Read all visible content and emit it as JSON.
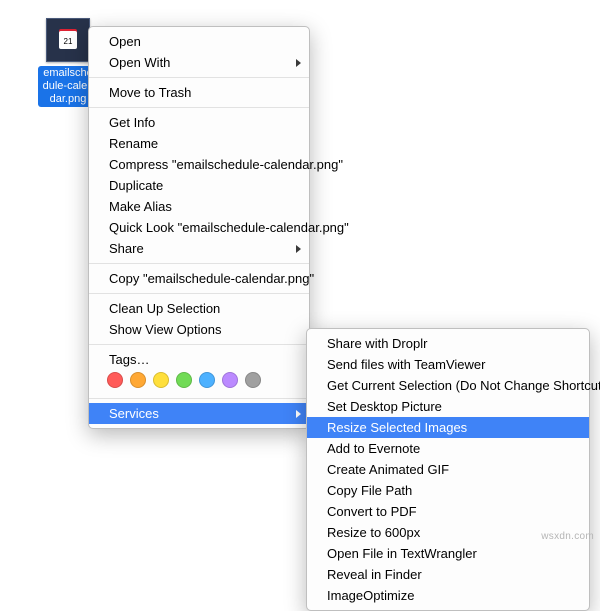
{
  "file": {
    "label": "emailschedule-calendar.png"
  },
  "menu": {
    "open": "Open",
    "open_with": "Open With",
    "move_to_trash": "Move to Trash",
    "get_info": "Get Info",
    "rename": "Rename",
    "compress": "Compress \"emailschedule-calendar.png\"",
    "duplicate": "Duplicate",
    "make_alias": "Make Alias",
    "quick_look": "Quick Look \"emailschedule-calendar.png\"",
    "share": "Share",
    "copy": "Copy \"emailschedule-calendar.png\"",
    "clean_up": "Clean Up Selection",
    "show_view_options": "Show View Options",
    "tags_label": "Tags…",
    "services": "Services"
  },
  "tag_colors": [
    "#ff5b59",
    "#ffa834",
    "#ffdf3b",
    "#71db56",
    "#4db1ff",
    "#bb8aff",
    "#a0a0a0"
  ],
  "services": {
    "share_droplr": "Share with Droplr",
    "send_teamviewer": "Send files with TeamViewer",
    "get_selection": "Get Current Selection (Do Not Change Shortcut)",
    "set_desktop": "Set Desktop Picture",
    "resize_selected": "Resize Selected Images",
    "add_evernote": "Add to Evernote",
    "create_gif": "Create Animated GIF",
    "copy_path": "Copy File Path",
    "to_pdf": "Convert to PDF",
    "resize_600": "Resize to 600px",
    "open_textwrangler": "Open File in TextWrangler",
    "reveal_finder": "Reveal in Finder",
    "image_optimize": "ImageOptimize"
  },
  "watermark": "wsxdn.com"
}
